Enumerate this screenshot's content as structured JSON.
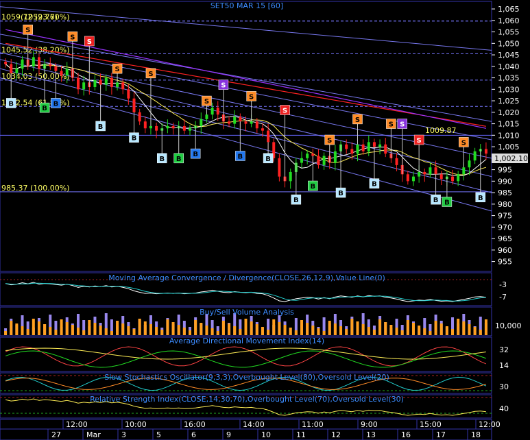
{
  "chart": {
    "title": "SET50 MAR 15   [60]",
    "last_price_label": "1,002.10",
    "peak_annotation": "1009.87"
  },
  "fib_levels": [
    {
      "label": "(1059.77)",
      "value": 1059.77
    },
    {
      "label": "1059.72 (23.60%)",
      "value": 1059.72
    },
    {
      "label": "1045.52 (38.20%)",
      "value": 1045.52
    },
    {
      "label": "1034.03 (50.00%)",
      "value": 1034.03
    },
    {
      "label": "1022.54 (61.80%)",
      "value": 1022.54
    },
    {
      "label": "985.37 (100.00%)",
      "value": 985.37
    }
  ],
  "panels": {
    "macd": {
      "title": "Moving Average Convergence / Divergence(CLOSE,26,12,9),Value Line(0)",
      "ticks": [
        "-3",
        "-7"
      ]
    },
    "volume": {
      "title": "Buy/Sell Volume Analysis",
      "ticks": [
        "10,000"
      ]
    },
    "adx": {
      "title": "Average Directional Movement Index(14)",
      "ticks": [
        "32",
        "14"
      ]
    },
    "stoch": {
      "title": "Slow Stochastics Oscillator(9,3,3),Overbought Level(80),Oversold Level(20)",
      "ticks": [
        "30"
      ]
    },
    "rsi": {
      "title": "Relative Strength Index(CLOSE,14,30,70),Overbought Level(70),Oversold Level(30)",
      "ticks": [
        "40"
      ]
    }
  },
  "time_axis": {
    "times": [
      "12:00",
      "10:00",
      "16:00",
      "14:00",
      "11:00",
      "9:00",
      "15:00",
      "12:00"
    ],
    "dates": [
      "27",
      "Mar",
      "3",
      "5",
      "6",
      "9",
      "10",
      "11",
      "12",
      "13",
      "16",
      "17",
      "18"
    ]
  },
  "chart_data": {
    "type": "candlestick",
    "title": "SET50 MAR 15   [60]",
    "ylim": [
      951,
      1068
    ],
    "y_ticks": [
      1065,
      1060,
      1055,
      1050,
      1045,
      1040,
      1035,
      1030,
      1025,
      1020,
      1015,
      1010,
      1005,
      1000,
      995,
      990,
      985,
      980,
      975,
      970,
      965,
      960,
      955
    ],
    "y_tick_labels": [
      "1,065",
      "1,060",
      "1,055",
      "1,050",
      "1,045",
      "1,040",
      "1,035",
      "1,030",
      "1,025",
      "1,020",
      "1,015",
      "1,010",
      "1,005",
      "1,000",
      "995",
      "990",
      "985",
      "980",
      "975",
      "970",
      "965",
      "960",
      "955"
    ],
    "close": [
      1041,
      1037,
      1039,
      1043,
      1040,
      1044,
      1039,
      1041,
      1040,
      1038,
      1036,
      1039,
      1035,
      1030,
      1033,
      1031,
      1034,
      1032,
      1035,
      1031,
      1033,
      1030,
      1026,
      1020,
      1016,
      1013,
      1014,
      1012,
      1013,
      1014,
      1013,
      1014,
      1012,
      1013,
      1014,
      1017,
      1019,
      1022,
      1019,
      1016,
      1015,
      1018,
      1016,
      1015,
      1016,
      1013,
      1012,
      1007,
      1000,
      992,
      990,
      994,
      998,
      1000,
      1002,
      1001,
      997,
      1001,
      998,
      1003,
      1006,
      1004,
      1002,
      1006,
      1003,
      1007,
      1005,
      1006,
      1002,
      1000,
      997,
      993,
      990,
      992,
      994,
      993,
      996,
      993,
      991,
      992,
      990,
      993,
      996,
      999,
      1003,
      1004,
      1002
    ],
    "signals": [
      {
        "type": "B",
        "price": 1024,
        "color": "light"
      },
      {
        "type": "S",
        "price": 1056,
        "color": "orange"
      },
      {
        "type": "B",
        "price": 1022,
        "color": "green"
      },
      {
        "type": "B",
        "price": 1024,
        "color": "blue"
      },
      {
        "type": "S",
        "price": 1053,
        "color": "orange"
      },
      {
        "type": "S",
        "price": 1051,
        "color": "red"
      },
      {
        "type": "B",
        "price": 1014,
        "color": "light"
      },
      {
        "type": "S",
        "price": 1039,
        "color": "orange"
      },
      {
        "type": "B",
        "price": 1009,
        "color": "light"
      },
      {
        "type": "S",
        "price": 1037,
        "color": "orange"
      },
      {
        "type": "B",
        "price": 1000,
        "color": "light"
      },
      {
        "type": "B",
        "price": 1000,
        "color": "green"
      },
      {
        "type": "B",
        "price": 1002,
        "color": "blue"
      },
      {
        "type": "S",
        "price": 1025,
        "color": "orange"
      },
      {
        "type": "S",
        "price": 1032,
        "color": "purple"
      },
      {
        "type": "B",
        "price": 1001,
        "color": "blue"
      },
      {
        "type": "S",
        "price": 1027,
        "color": "orange"
      },
      {
        "type": "B",
        "price": 1000,
        "color": "light"
      },
      {
        "type": "S",
        "price": 1021,
        "color": "red"
      },
      {
        "type": "B",
        "price": 982,
        "color": "light"
      },
      {
        "type": "B",
        "price": 988,
        "color": "green"
      },
      {
        "type": "S",
        "price": 1008,
        "color": "orange"
      },
      {
        "type": "B",
        "price": 985,
        "color": "light"
      },
      {
        "type": "S",
        "price": 1017,
        "color": "orange"
      },
      {
        "type": "B",
        "price": 989,
        "color": "light"
      },
      {
        "type": "S",
        "price": 1015,
        "color": "orange"
      },
      {
        "type": "S",
        "price": 1015,
        "color": "purple"
      },
      {
        "type": "S",
        "price": 1008,
        "color": "red"
      },
      {
        "type": "B",
        "price": 982,
        "color": "light"
      },
      {
        "type": "B",
        "price": 981,
        "color": "green"
      },
      {
        "type": "S",
        "price": 1007,
        "color": "orange"
      },
      {
        "type": "B",
        "price": 983,
        "color": "light"
      }
    ],
    "colors": {
      "up": "#22dd22",
      "down": "#ff2222",
      "grid": "#3333aa",
      "fib": "#7777ff",
      "ma_red": "#ff2222",
      "ma_purple": "#9933ff",
      "ma_yellow": "#ffee55",
      "ma_white": "#ffffff"
    }
  }
}
